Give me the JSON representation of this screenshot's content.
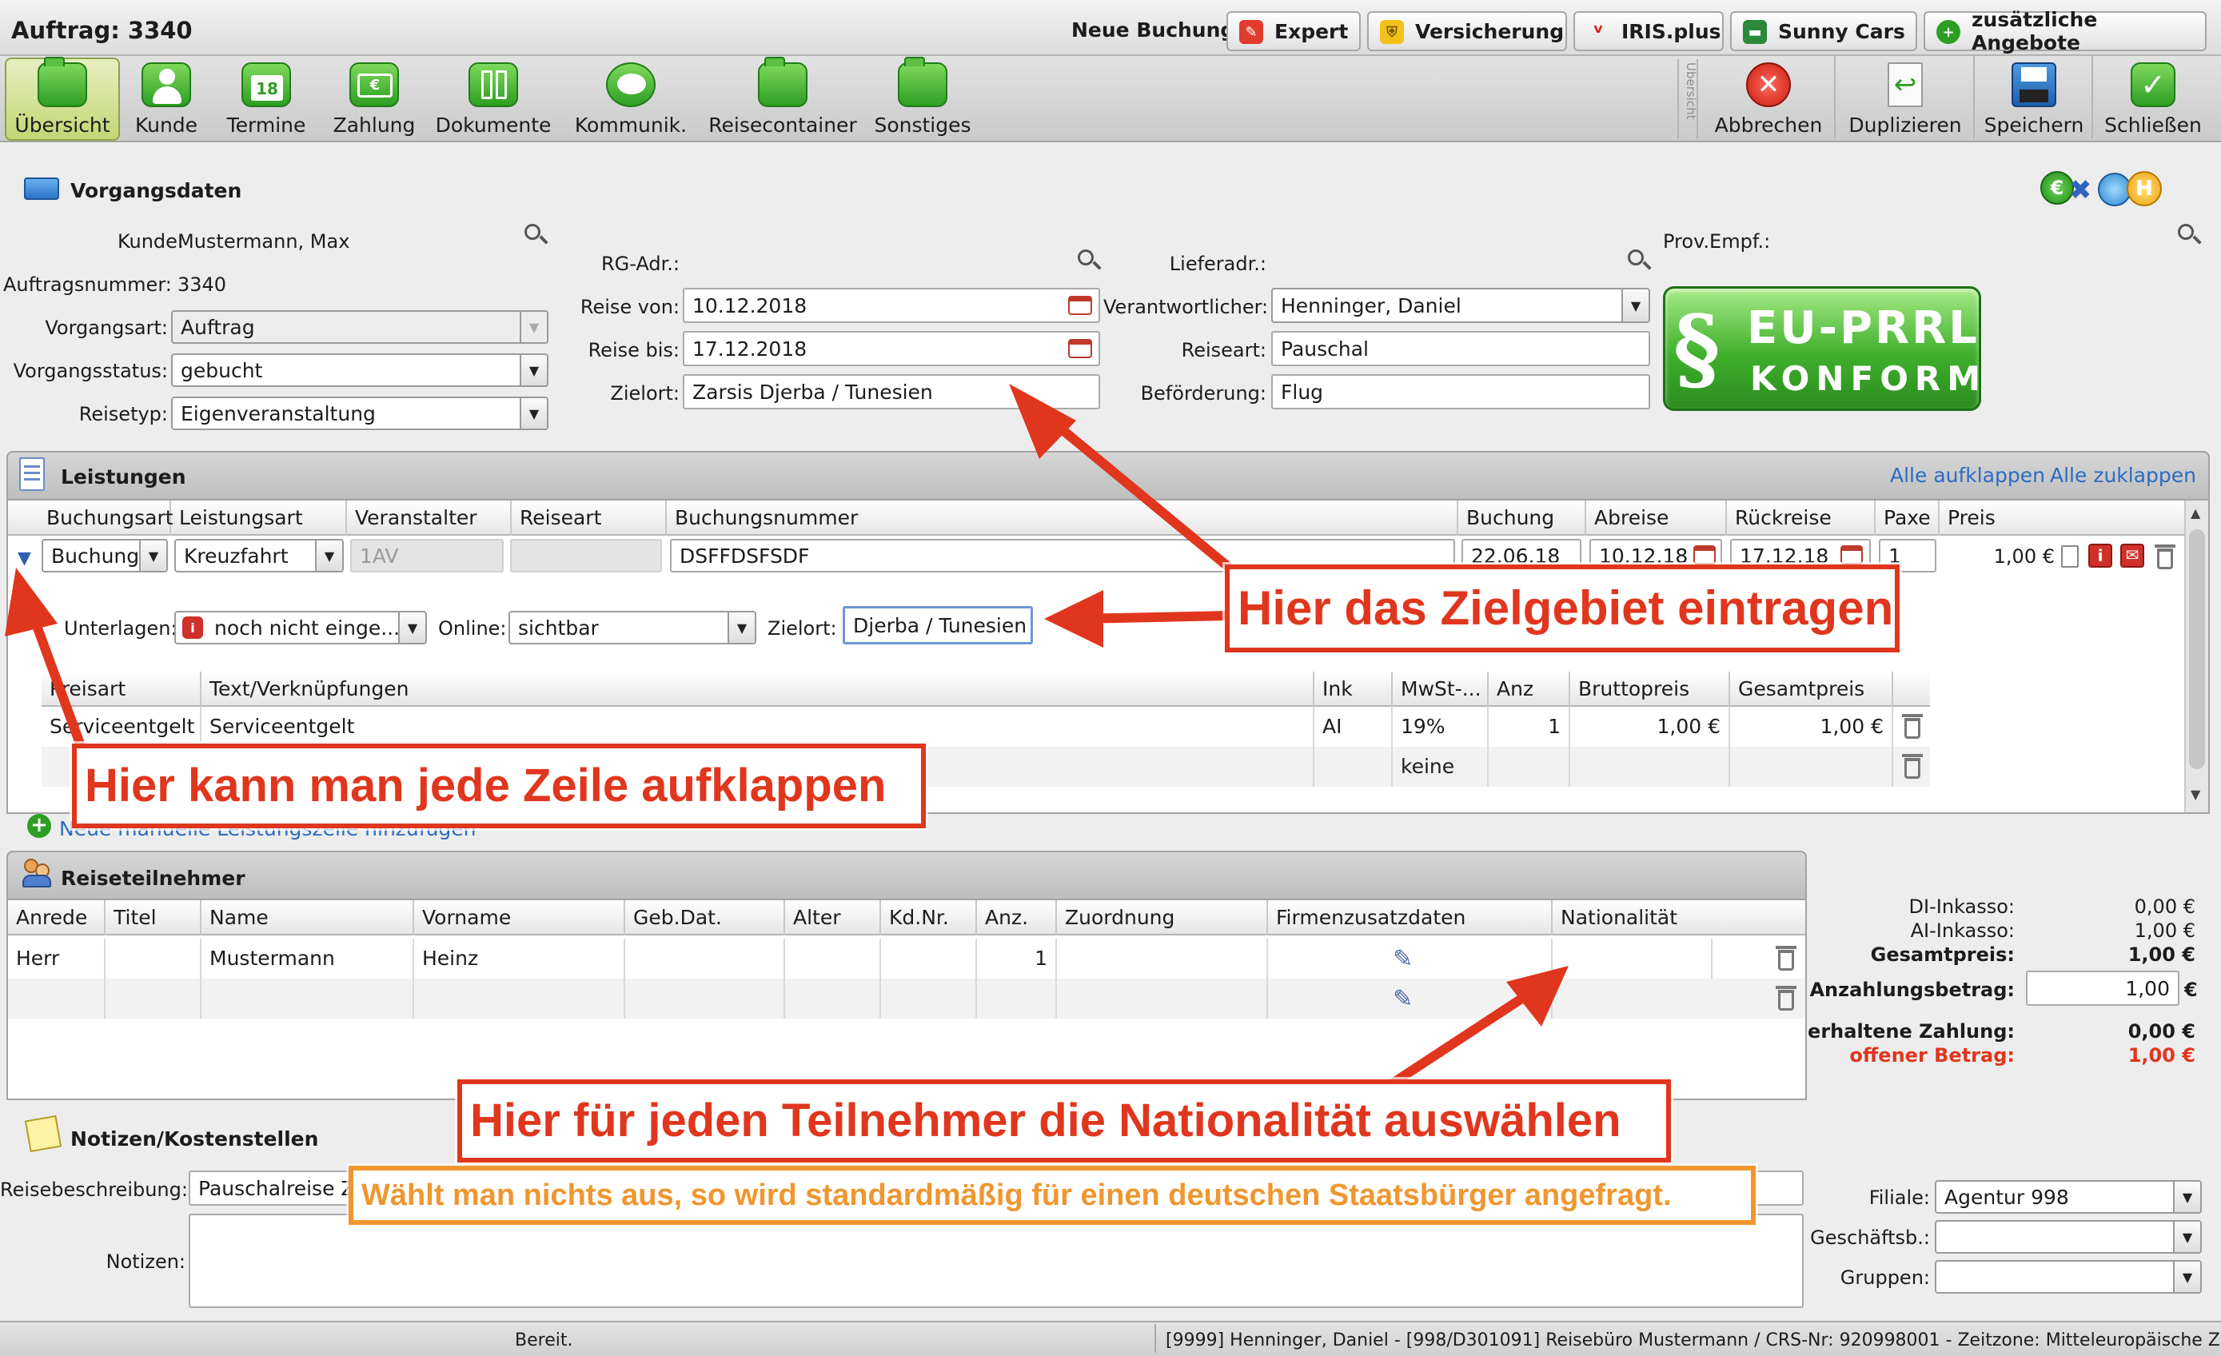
{
  "window": {
    "title": "Auftrag: 3340"
  },
  "new_booking": {
    "label": "Neue Buchung:",
    "buttons": [
      {
        "label": "Expert",
        "color": "#e03b2d"
      },
      {
        "label": "Versicherung",
        "color": "#f2c21b"
      },
      {
        "label": "IRIS.plus",
        "color": "#d9251c"
      },
      {
        "label": "Sunny Cars",
        "color": "#2a8a3a"
      },
      {
        "label": "zusätzliche Angebote",
        "color": "#2e9e23"
      }
    ]
  },
  "toolbar": {
    "tabs": [
      "Übersicht",
      "Kunde",
      "Termine",
      "Zahlung",
      "Dokumente",
      "Kommunik.",
      "Reisecontainer",
      "Sonstiges"
    ],
    "active_tab": "Übersicht",
    "vertical_label": "Übersicht",
    "actions": [
      "Abbrechen",
      "Duplizieren",
      "Speichern",
      "Schließen"
    ]
  },
  "vorgangsdaten": {
    "title": "Vorgangsdaten",
    "kunde_label": "Kunde:",
    "kunde": "Mustermann, Max",
    "auftragsnummer_label": "Auftragsnummer:",
    "auftragsnummer": "3340",
    "vorgangsart_label": "Vorgangsart:",
    "vorgangsart": "Auftrag",
    "vorgangsstatus_label": "Vorgangsstatus:",
    "vorgangsstatus": "gebucht",
    "reisetyp_label": "Reisetyp:",
    "reisetyp": "Eigenveranstaltung",
    "rg_adr_label": "RG-Adr.:",
    "reise_von_label": "Reise von:",
    "reise_von": "10.12.2018",
    "reise_bis_label": "Reise bis:",
    "reise_bis": "17.12.2018",
    "zielort_label": "Zielort:",
    "zielort": "Zarsis Djerba / Tunesien",
    "lieferadr_label": "Lieferadr.:",
    "verantwortlicher_label": "Verantwortlicher:",
    "verantwortlicher": "Henninger, Daniel",
    "reiseart_label": "Reiseart:",
    "reiseart": "Pauschal",
    "befoerderung_label": "Beförderung:",
    "befoerderung": "Flug",
    "prov_empf_label": "Prov.Empf.:",
    "badge_line1": "EU-PRRL",
    "badge_line2": "KONFORM",
    "badge_symbol": "§"
  },
  "leistungen": {
    "title": "Leistungen",
    "expand_all": "Alle aufklappen",
    "collapse_all": "Alle zuklappen",
    "columns": [
      "Buchungsart",
      "Leistungsart",
      "Veranstalter",
      "Reiseart",
      "Buchungsnummer",
      "Buchung",
      "Abreise",
      "Rückreise",
      "Paxe",
      "Preis"
    ],
    "row": {
      "buchungsart": "Buchung",
      "leistungsart": "Kreuzfahrt",
      "veranstalter": "1AV",
      "reiseart": "",
      "buchungsnummer": "DSFFDSFSDF",
      "buchung": "22.06.18",
      "abreise": "10.12.18",
      "rueckreise": "17.12.18",
      "paxe": "1",
      "preis": "1,00 €"
    },
    "detail": {
      "unterlagen_label": "Unterlagen:",
      "unterlagen": "noch nicht einge...",
      "online_label": "Online:",
      "online": "sichtbar",
      "zielort_label": "Zielort:",
      "zielort": "Djerba / Tunesien"
    },
    "price_columns": [
      "Preisart",
      "Text/Verknüpfungen",
      "Ink",
      "MwSt-...",
      "Anz",
      "Bruttopreis",
      "Gesamtpreis"
    ],
    "price_rows": [
      {
        "preisart": "Serviceentgelt",
        "text": "Serviceentgelt",
        "ink": "AI",
        "mwst": "19%",
        "anz": "1",
        "brutto": "1,00 €",
        "gesamt": "1,00 €"
      },
      {
        "preisart": "",
        "text": "",
        "ink": "",
        "mwst": "keine",
        "anz": "",
        "brutto": "",
        "gesamt": ""
      }
    ],
    "add_label": "Neue manuelle Leistungszeile hinzufügen"
  },
  "reiseteilnehmer": {
    "title": "Reiseteilnehmer",
    "columns": [
      "Anrede",
      "Titel",
      "Name",
      "Vorname",
      "Geb.Dat.",
      "Alter",
      "Kd.Nr.",
      "Anz.",
      "Zuordnung",
      "Firmenzusatzdaten",
      "Nationalität"
    ],
    "rows": [
      {
        "anrede": "Herr",
        "titel": "",
        "name": "Mustermann",
        "vorname": "Heinz",
        "gebdat": "",
        "alter": "",
        "kdnr": "",
        "anz": "1",
        "zuordnung": "",
        "nationalitaet": ""
      }
    ]
  },
  "summary": {
    "di_label": "DI-Inkasso:",
    "di": "0,00 €",
    "ai_label": "AI-Inkasso:",
    "ai": "1,00 €",
    "gesamt_label": "Gesamtpreis:",
    "gesamt": "1,00 €",
    "anzahlung_label": "Anzahlungsbetrag:",
    "anzahlung": "1,00",
    "currency": "€",
    "erhalten_label": "erhaltene Zahlung:",
    "erhalten": "0,00 €",
    "offen_label": "offener Betrag:",
    "offen": "1,00 €"
  },
  "notizen": {
    "title": "Notizen/Kostenstellen",
    "reisebeschreibung_label": "Reisebeschreibung:",
    "reisebeschreibung": "Pauschalreise Za",
    "notizen_label": "Notizen:",
    "filiale_label": "Filiale:",
    "filiale": "Agentur 998",
    "geschaeftsb_label": "Geschäftsb.:",
    "gruppen_label": "Gruppen:"
  },
  "status": {
    "left": "Bereit.",
    "right": "[9999] Henninger, Daniel - [998/D301091] Reisebüro Mustermann / CRS-Nr: 920998001 - Zeitzone: Mitteleuropäische Zeit"
  },
  "annotations": {
    "zielgebiet": "Hier das Zielgebiet eintragen",
    "aufklappen": "Hier kann man jede Zeile aufklappen",
    "nationalitaet": "Hier für jeden Teilnehmer die Nationalität auswählen",
    "hinweis": "Wählt man nichts aus, so wird standardmäßig für einen deutschen Staatsbürger angefragt."
  },
  "colors": {
    "accent_red": "#e0361d",
    "accent_orange": "#f0962f",
    "link_blue": "#2b6cc4",
    "open_amount": "#e0361d"
  }
}
